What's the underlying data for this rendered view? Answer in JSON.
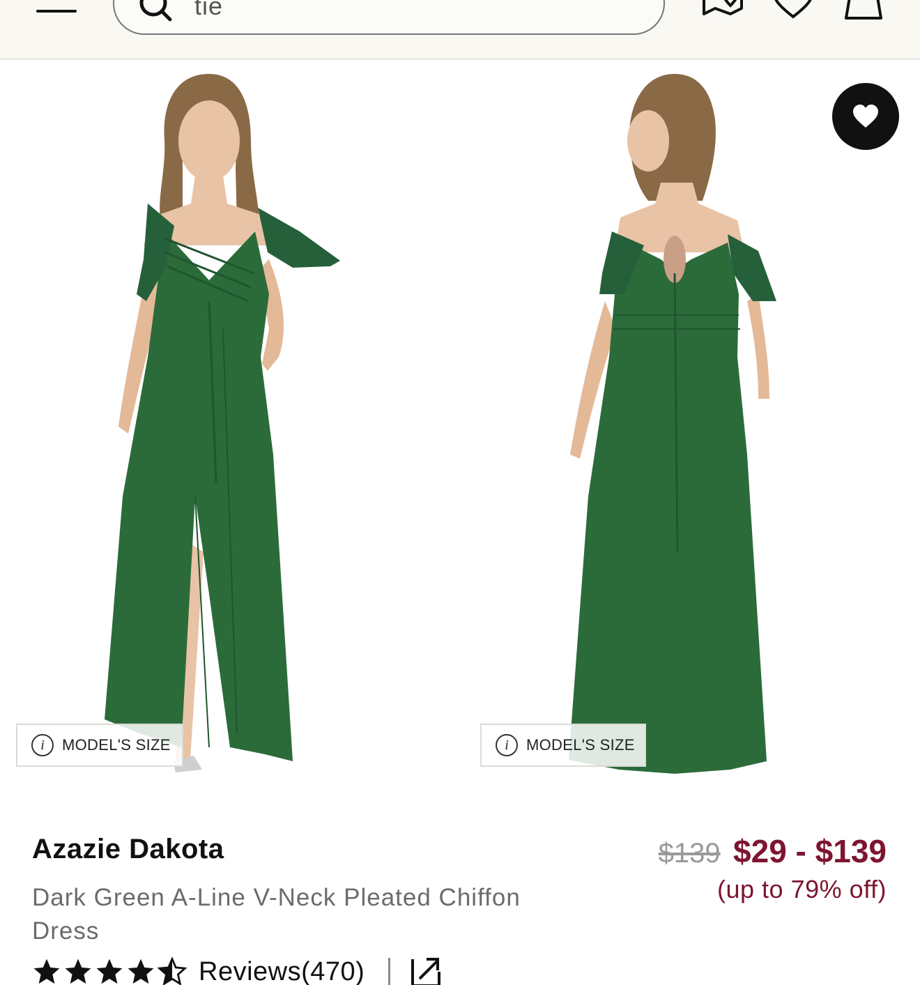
{
  "header": {
    "search_query": "tie"
  },
  "gallery": {
    "front_image_alt": "Dark Green A-Line V-Neck Pleated Chiffon Dress - front view",
    "back_image_alt": "Dark Green A-Line V-Neck Pleated Chiffon Dress - back view",
    "size_tag_label": "MODEL'S SIZE",
    "dress_color": "#2b6b3a"
  },
  "product": {
    "brand": "Azazie Dakota",
    "description": "Dark Green A-Line V-Neck Pleated Chiffon Dress",
    "original_price": "$139",
    "price_range": "$29 - $139",
    "discount": "(up to 79% off)",
    "rating": 4.5,
    "reviews_label": "Reviews(470)"
  },
  "colors": {
    "accent": "#7d1530",
    "header_bg": "#f9f8f3"
  }
}
